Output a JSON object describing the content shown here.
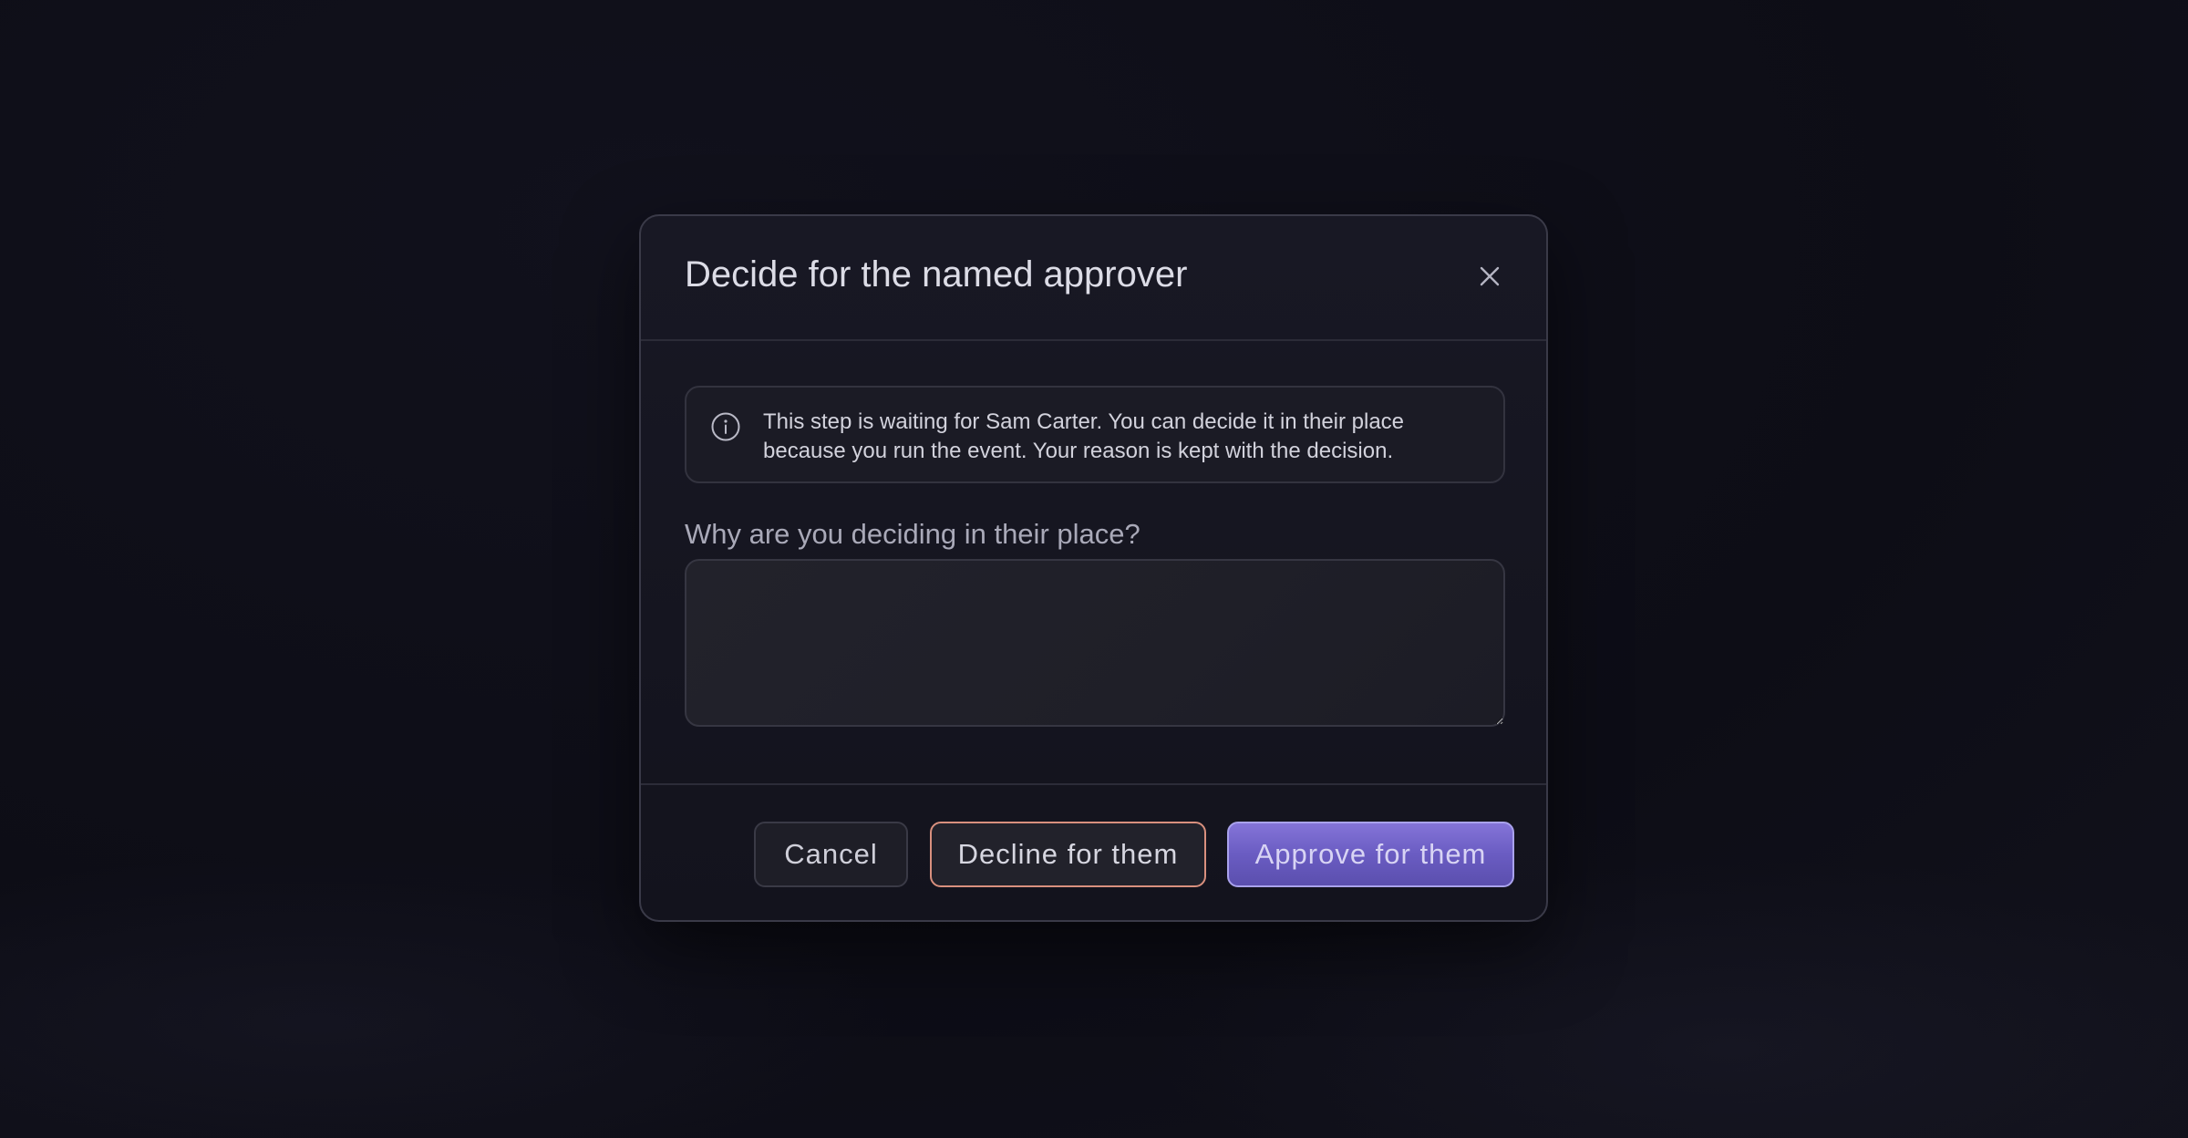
{
  "dialog": {
    "title": "Decide for the named approver",
    "close_icon": "close-icon",
    "info": {
      "icon": "info-icon",
      "text": "This step is waiting for Sam Carter. You can decide it in their place because you run the event. Your reason is kept with the decision."
    },
    "reason_field": {
      "label": "Why are you deciding in their place?",
      "value": "",
      "placeholder": ""
    },
    "buttons": {
      "cancel_label": "Cancel",
      "decline_label": "Decline for them",
      "approve_label": "Approve for them"
    }
  },
  "colors": {
    "background": "#0e0e17",
    "modal": "#161620",
    "decline_border": "#d9907e",
    "approve_fill": "#7465cc"
  }
}
